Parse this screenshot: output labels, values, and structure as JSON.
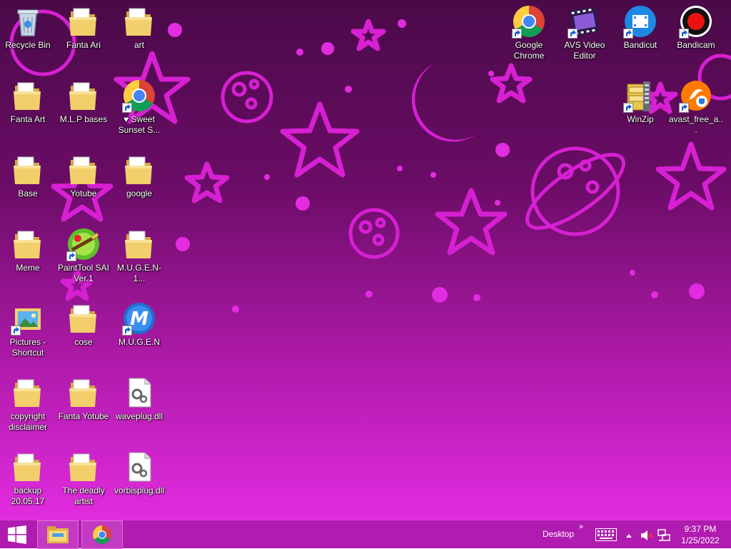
{
  "desktop_icons": [
    {
      "label": "Recycle Bin",
      "icon": "recycle-bin-icon"
    },
    {
      "label": "Fanta Ari",
      "icon": "folder-icon"
    },
    {
      "label": "art",
      "icon": "folder-icon"
    },
    {
      "label": "Fanta Art",
      "icon": "folder-icon"
    },
    {
      "label": "M.L.P bases",
      "icon": "folder-icon"
    },
    {
      "label": "♥ Sweet Sunset S...",
      "icon": "chrome-icon"
    },
    {
      "label": "Base",
      "icon": "folder-icon"
    },
    {
      "label": "Yotube",
      "icon": "folder-icon"
    },
    {
      "label": "google",
      "icon": "folder-icon"
    },
    {
      "label": "Meme",
      "icon": "folder-icon"
    },
    {
      "label": "PaintTool SAI Ver.1",
      "icon": "painttool-sai-icon"
    },
    {
      "label": "M.U.G.E.N-1...",
      "icon": "folder-icon"
    },
    {
      "label": "Pictures - Shortcut",
      "icon": "pictures-icon"
    },
    {
      "label": "cose",
      "icon": "folder-icon"
    },
    {
      "label": "M.U.G.E.N",
      "icon": "mugen-icon"
    },
    {
      "label": "copyright disclaimer",
      "icon": "folder-icon"
    },
    {
      "label": "Fanta Yotube",
      "icon": "folder-icon"
    },
    {
      "label": "waveplug.dll",
      "icon": "dll-file-icon"
    },
    {
      "label": "backup 20.05.17",
      "icon": "folder-icon"
    },
    {
      "label": "The deadly artist",
      "icon": "folder-icon"
    },
    {
      "label": "vorbisplug.dll",
      "icon": "dll-file-icon"
    },
    {
      "label": "Google Chrome",
      "icon": "chrome-icon"
    },
    {
      "label": "AVS Video Editor",
      "icon": "avs-video-editor-icon"
    },
    {
      "label": "Bandicut",
      "icon": "bandicut-icon"
    },
    {
      "label": "Bandicam",
      "icon": "bandicam-icon"
    },
    {
      "label": "WinZip",
      "icon": "winzip-icon"
    },
    {
      "label": "avast_free_a...",
      "icon": "avast-icon"
    }
  ],
  "taskbar": {
    "start_icon": "windows-start-icon",
    "pinned": [
      "file-explorer-icon",
      "chrome-icon"
    ],
    "desktop_label": "Desktop",
    "toolbar_chevron": "»",
    "tray_icons": [
      "keyboard-icon",
      "show-hidden-icons-icon",
      "speaker-muted-icon",
      "network-icon"
    ],
    "clock_time": "9:37 PM",
    "clock_date": "1/25/2022"
  },
  "colors": {
    "taskbar": "#b01bb0",
    "wallpaper_top": "#4a0a48",
    "wallpaper_bottom": "#e22ce0",
    "star_pink": "#e22ce0"
  }
}
